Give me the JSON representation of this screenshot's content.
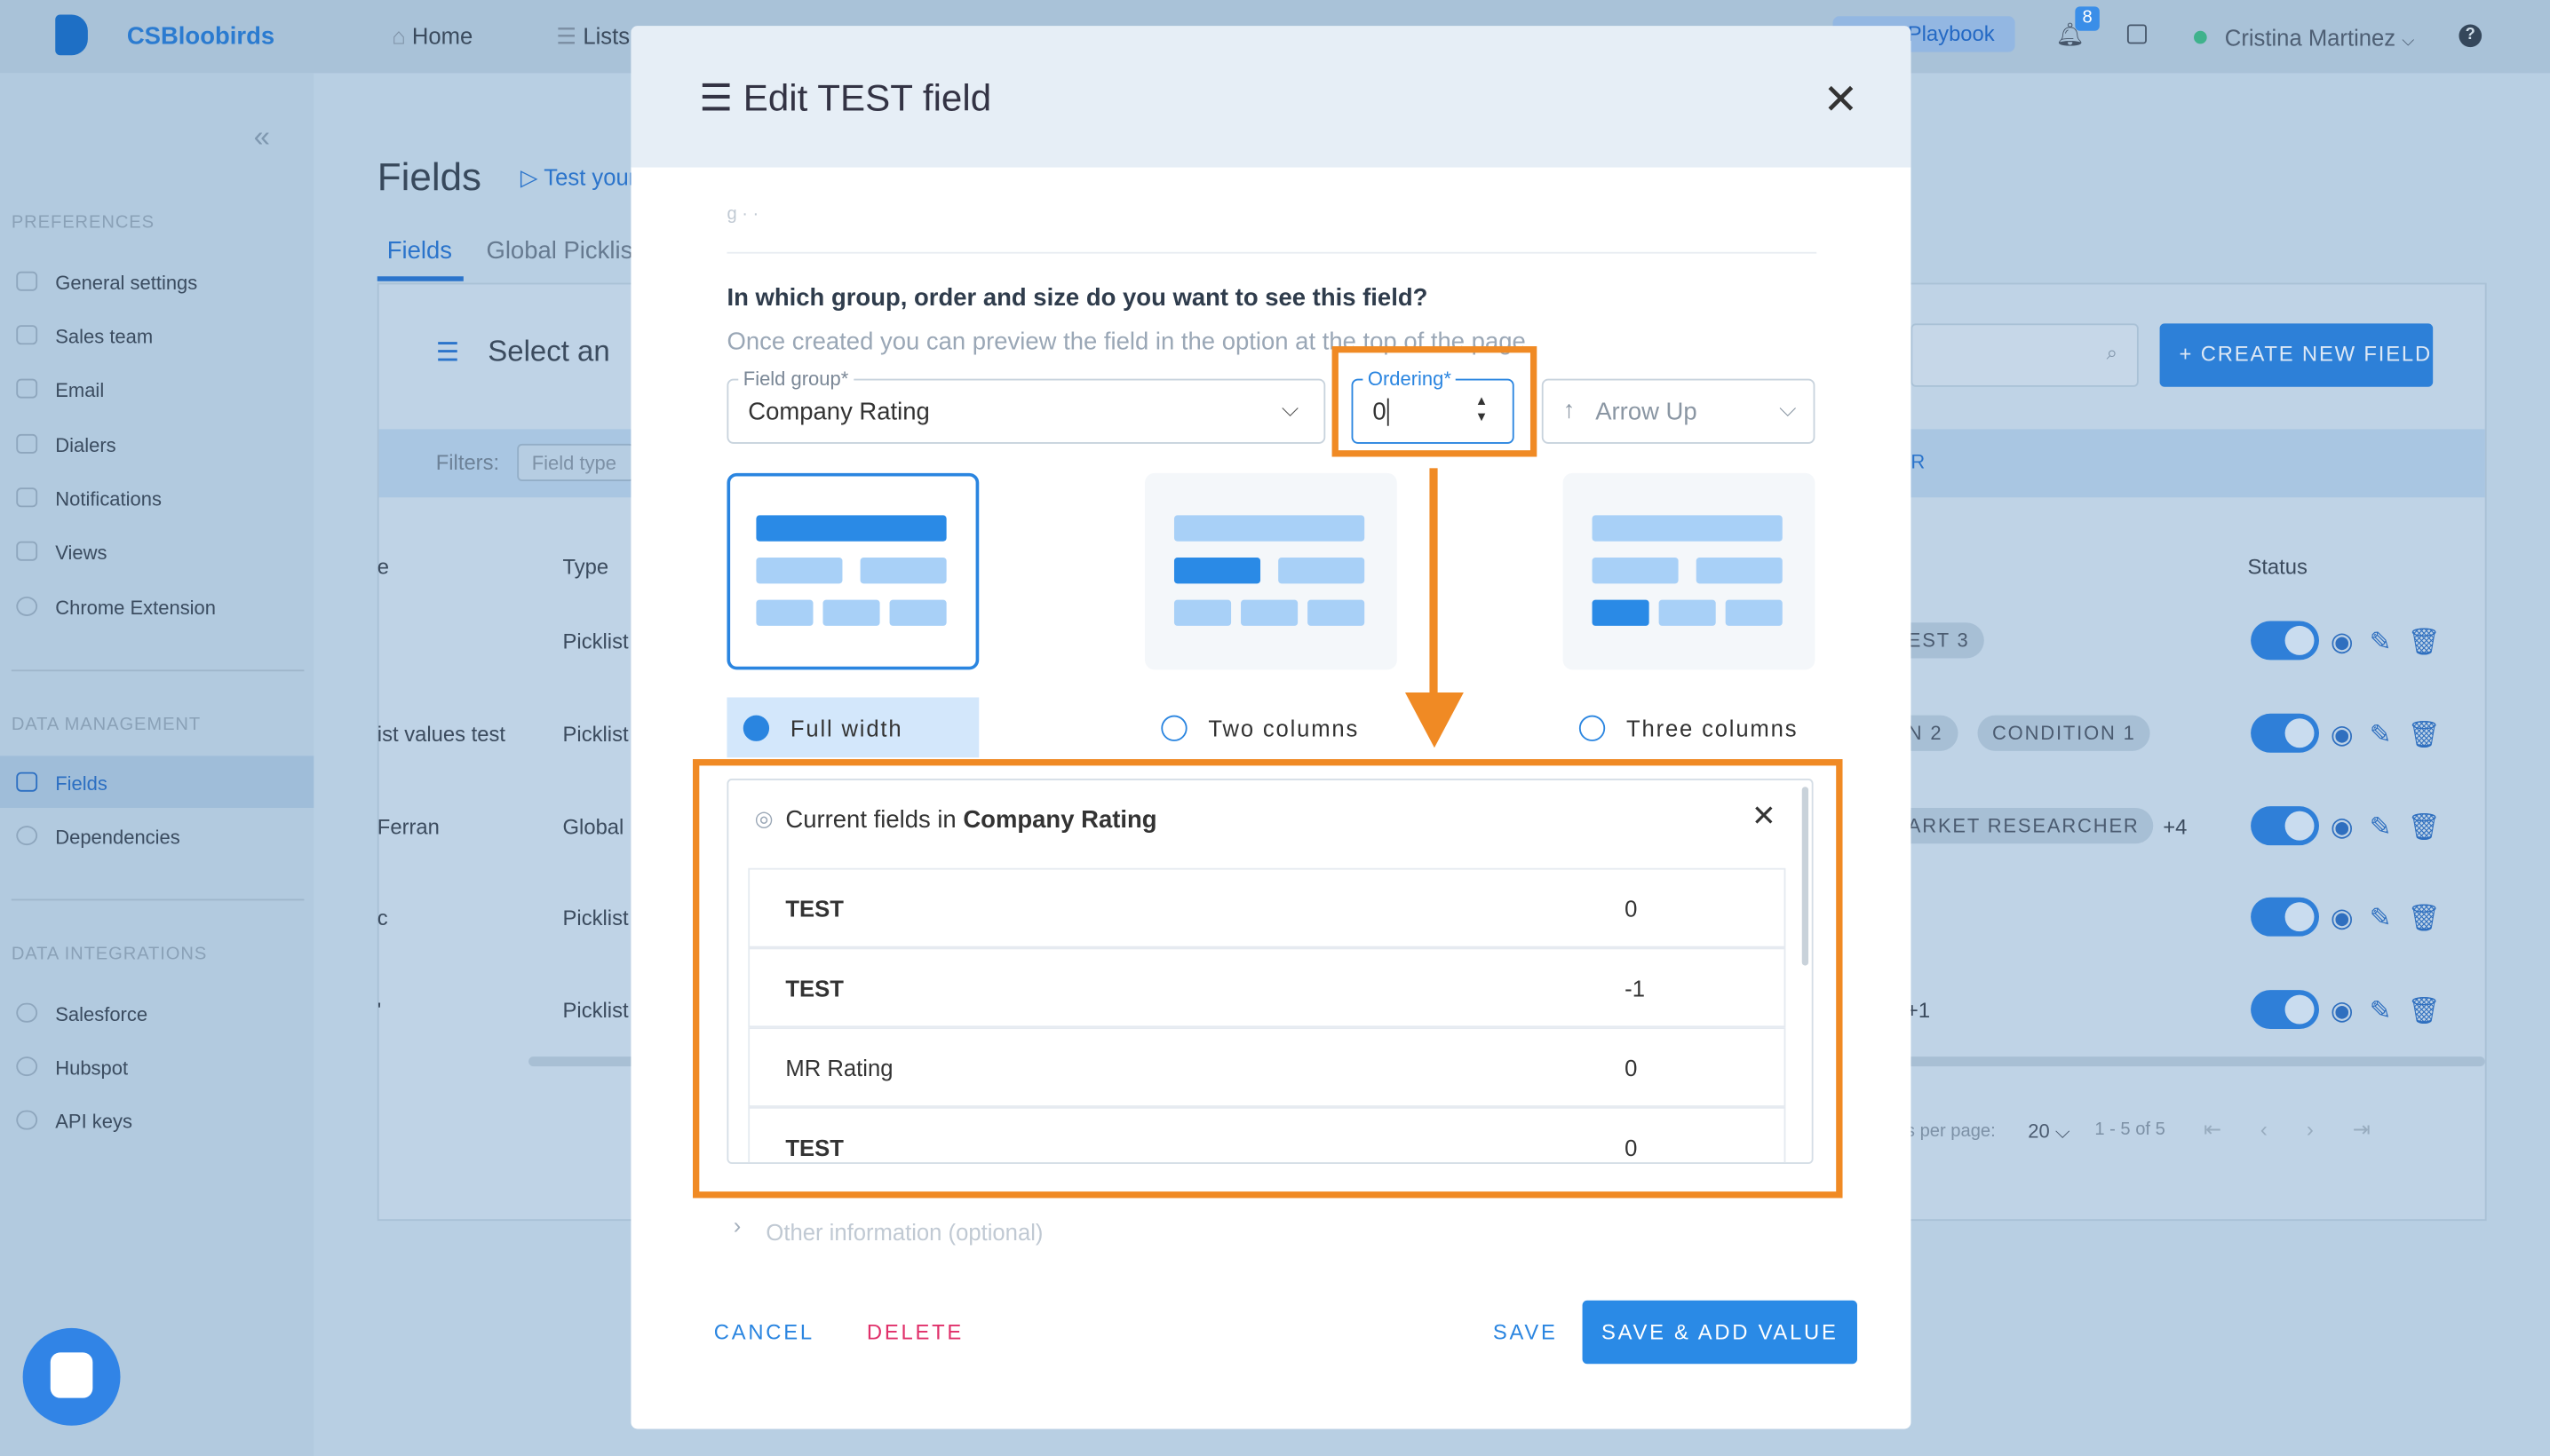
{
  "app": {
    "name": "CSBloobirds"
  },
  "topnav": {
    "home": "Home",
    "lists": "Lists",
    "playbook": "Playbook",
    "notif_count": "8",
    "user": "Cristina Martinez",
    "help": "?"
  },
  "sidebar": {
    "section_preferences": "PREFERENCES",
    "preferences": [
      "General settings",
      "Sales team",
      "Email",
      "Dialers",
      "Notifications",
      "Views",
      "Chrome Extension"
    ],
    "section_data_management": "DATA MANAGEMENT",
    "data_management": [
      "Fields",
      "Dependencies"
    ],
    "section_data_integrations": "DATA INTEGRATIONS",
    "data_integrations": [
      "Salesforce",
      "Hubspot",
      "API keys"
    ]
  },
  "page": {
    "title": "Fields",
    "test_link": "Test your",
    "tabs": [
      "Fields",
      "Global Picklis"
    ],
    "select_label": "Select an",
    "filters_label": "Filters:",
    "field_type_placeholder": "Field type",
    "create_button": "+ CREATE NEW FIELD",
    "filter_r": "R"
  },
  "table": {
    "col_e": "e",
    "col_type": "Type",
    "col_status": "Status",
    "rows": [
      {
        "name": "",
        "type": "Picklist",
        "tags": [
          "EST 3"
        ]
      },
      {
        "name": "ist values test",
        "type": "Picklist",
        "tags": [
          "N 2",
          "CONDITION 1"
        ]
      },
      {
        "name": "Ferran",
        "type": "Global",
        "tags": [
          "ARKET RESEARCHER",
          "+4"
        ]
      },
      {
        "name": "c",
        "type": "Picklist",
        "tags": []
      },
      {
        "name": "'",
        "type": "Picklist",
        "tags": [
          "+1"
        ]
      }
    ],
    "pagination": {
      "per_page_label": "s per page:",
      "per_page": "20",
      "range": "1 - 5 of 5"
    }
  },
  "modal": {
    "title": "Edit TEST field",
    "question": "In which group, order and size do you want to see this field?",
    "hint": "Once created you can preview the field in the option at the top of the page.",
    "field_group_label": "Field group*",
    "field_group_value": "Company Rating",
    "ordering_label": "Ordering*",
    "ordering_value": "0",
    "direction_value": "Arrow Up",
    "layouts": [
      "Full width",
      "Two columns",
      "Three columns"
    ],
    "selected_layout": "Full width",
    "popover": {
      "title_prefix": "Current fields in ",
      "title_group": "Company Rating",
      "rows": [
        {
          "name": "TEST",
          "value": "0"
        },
        {
          "name": "TEST",
          "value": "-1"
        },
        {
          "name": "MR Rating",
          "value": "0"
        },
        {
          "name": "TEST",
          "value": "0"
        }
      ]
    },
    "other_info": "Other information (optional)",
    "buttons": {
      "cancel": "CANCEL",
      "delete": "DELETE",
      "save": "SAVE",
      "save_add": "SAVE & ADD VALUE"
    }
  },
  "colors": {
    "accent": "#2a8ae6",
    "highlight": "#f08a24",
    "delete": "#e0306a"
  }
}
